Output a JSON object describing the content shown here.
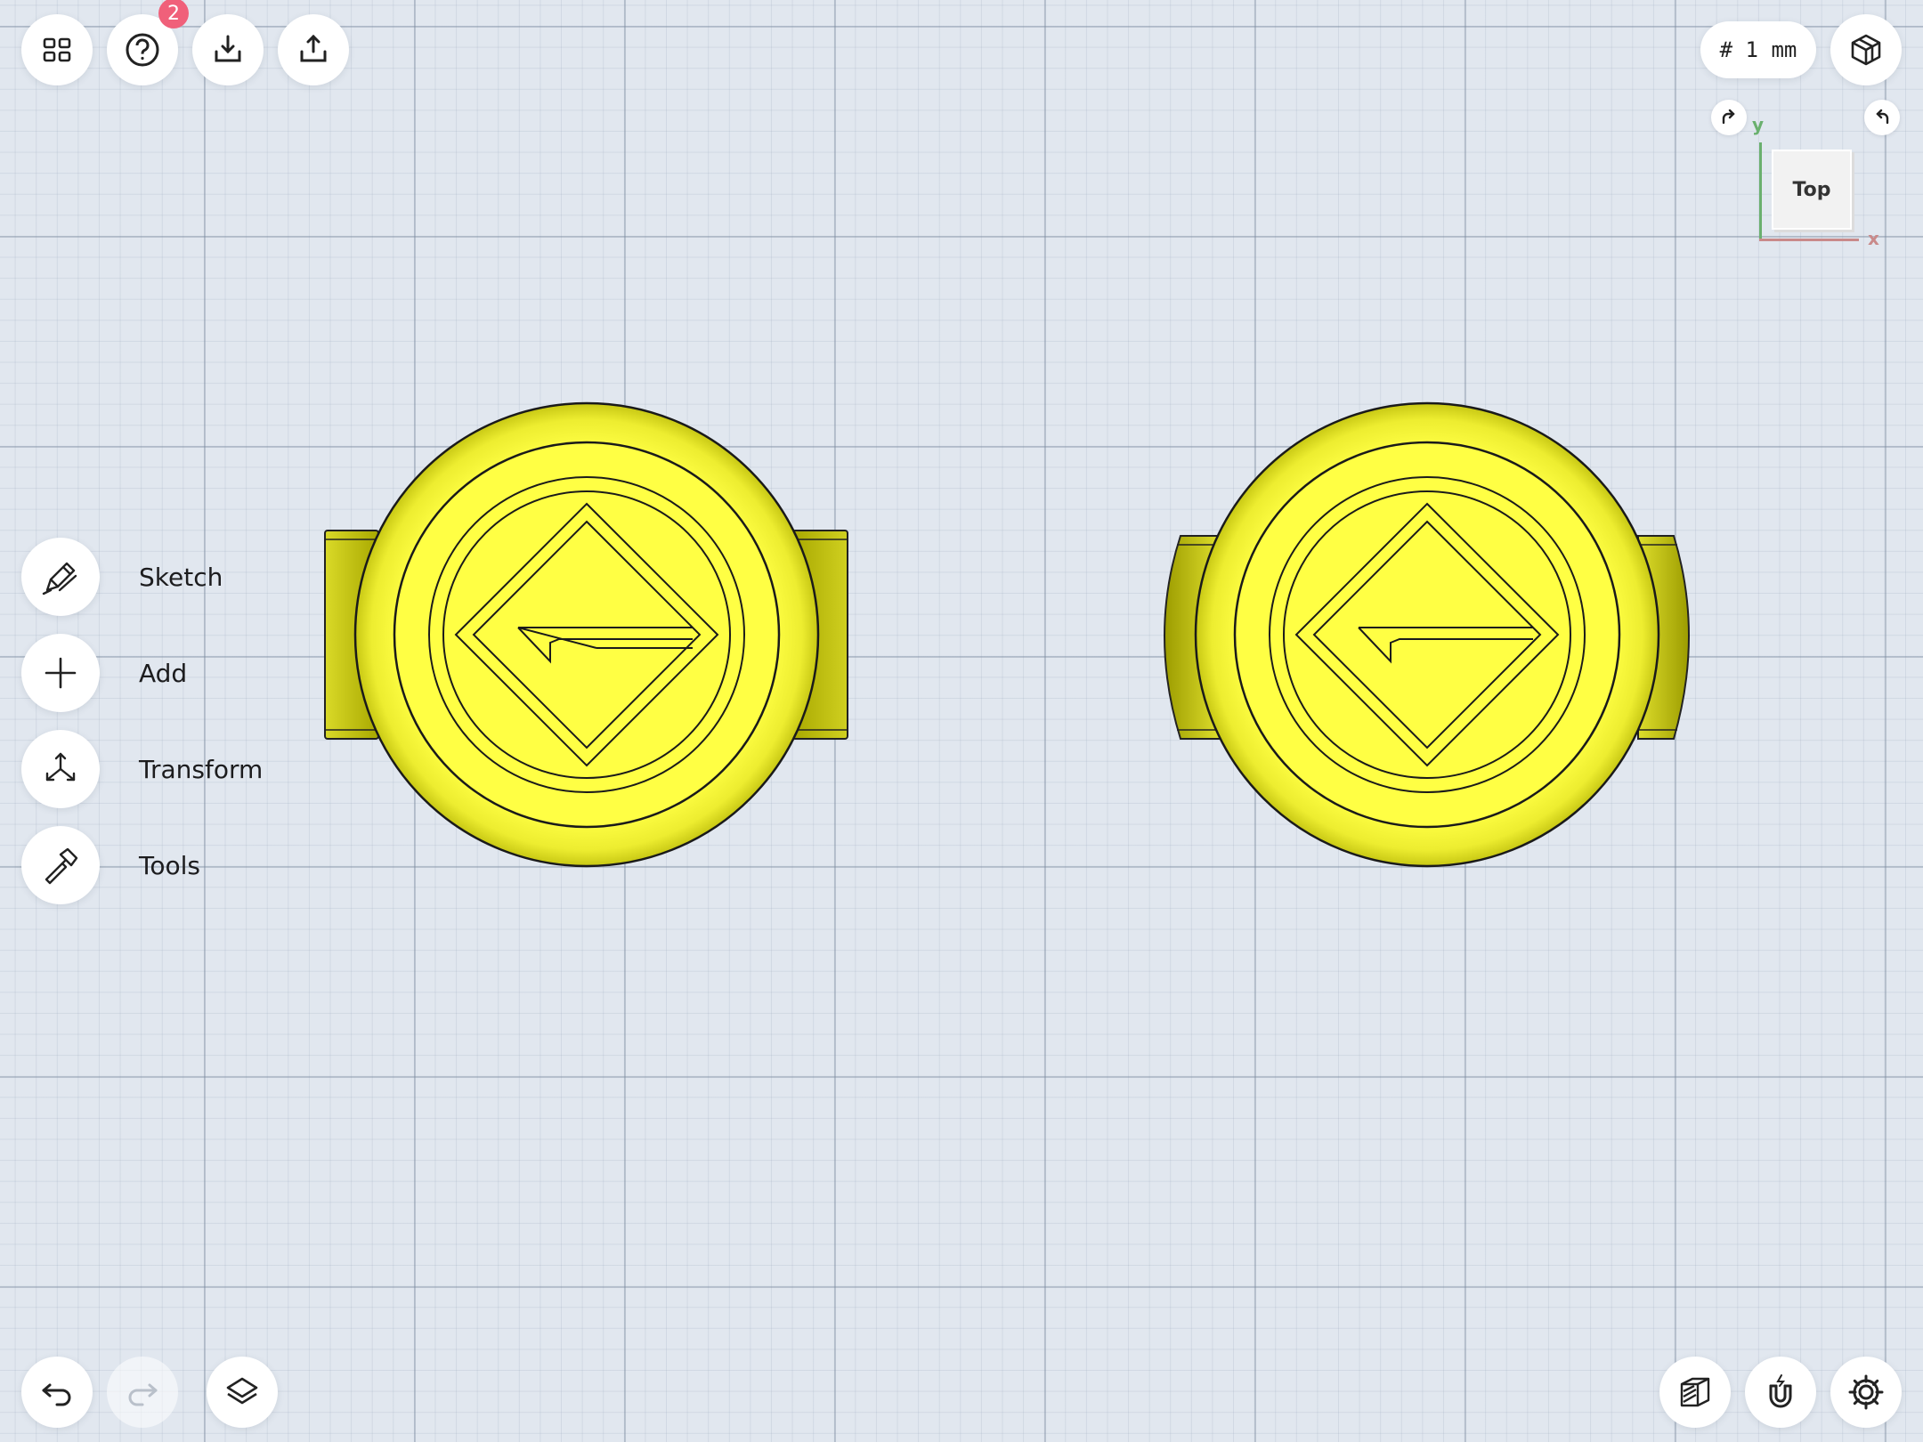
{
  "toolbar_top": {
    "grid_label": "# 1 mm",
    "help_badge": "2",
    "icons": [
      "apps-grid-icon",
      "help-icon",
      "import-icon",
      "export-icon",
      "view-cube-icon"
    ]
  },
  "viewcube": {
    "face_label": "Top",
    "axis_y": "y",
    "axis_x": "x"
  },
  "side_menu": {
    "items": [
      {
        "label": "Sketch",
        "icon": "pencil-icon"
      },
      {
        "label": "Add",
        "icon": "plus-icon"
      },
      {
        "label": "Transform",
        "icon": "transform-icon"
      },
      {
        "label": "Tools",
        "icon": "hammer-icon"
      }
    ]
  },
  "toolbar_bottom": {
    "icons": [
      "undo-icon",
      "redo-icon",
      "layers-icon",
      "material-icon",
      "snap-magnet-icon",
      "settings-gear-icon"
    ]
  },
  "colors": {
    "model_fill": "#ffff44",
    "model_shade": "#b8b800",
    "background": "#e1e7ef",
    "badge": "#f0607a"
  }
}
